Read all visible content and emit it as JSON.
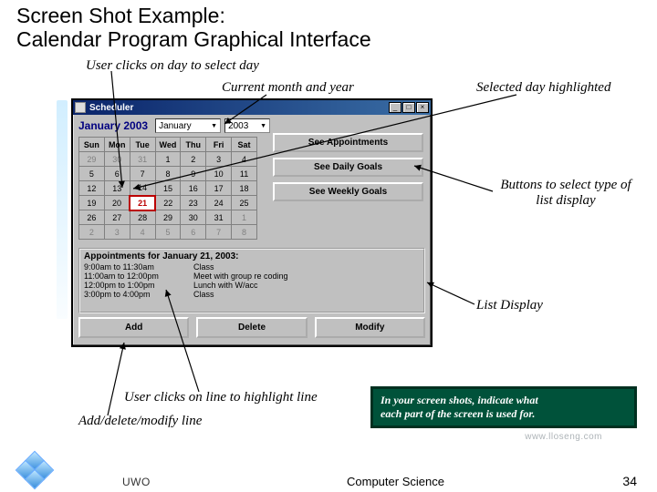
{
  "slide": {
    "title_line1": "Screen Shot Example:",
    "title_line2": "Calendar Program Graphical Interface"
  },
  "annotations": {
    "user_clicks_day": "User clicks on day to select day",
    "current_month": "Current month and year",
    "selected_day": "Selected day highlighted",
    "buttons_type": "Buttons to select type of list display",
    "list_display": "List Display",
    "user_clicks_line": "User clicks on line to highlight line",
    "add_delete_modify": "Add/delete/modify line"
  },
  "tip": {
    "line1": "In your screen shots, indicate what",
    "line2": "each part of the screen is used for."
  },
  "window": {
    "title": "Scheduler",
    "month_label": "January 2003",
    "month_select": "January",
    "year_select": "2003",
    "days": [
      "Sun",
      "Mon",
      "Tue",
      "Wed",
      "Thu",
      "Fri",
      "Sat"
    ],
    "rows": [
      [
        "29",
        "30",
        "31",
        "1",
        "2",
        "3",
        "4"
      ],
      [
        "5",
        "6",
        "7",
        "8",
        "9",
        "10",
        "11"
      ],
      [
        "12",
        "13",
        "14",
        "15",
        "16",
        "17",
        "18"
      ],
      [
        "19",
        "20",
        "21",
        "22",
        "23",
        "24",
        "25"
      ],
      [
        "26",
        "27",
        "28",
        "29",
        "30",
        "31",
        "1"
      ],
      [
        "2",
        "3",
        "4",
        "5",
        "6",
        "7",
        "8"
      ]
    ],
    "selected_cell": "21",
    "off_first": 3,
    "off_last_row5": 1,
    "side_buttons": [
      "See Appointments",
      "See Daily Goals",
      "See Weekly Goals"
    ],
    "appt_header": "Appointments for January 21, 2003:",
    "appts": [
      {
        "time": "9:00am to 11:30am",
        "desc": "Class"
      },
      {
        "time": "11:00am to 12:00pm",
        "desc": "Meet with group re coding"
      },
      {
        "time": "12:00pm to 1:00pm",
        "desc": "Lunch with W/acc"
      },
      {
        "time": "3:00pm to 4:00pm",
        "desc": "Class"
      }
    ],
    "bottom_buttons": [
      "Add",
      "Delete",
      "Modify"
    ]
  },
  "footer": {
    "pagenum": "34",
    "center": "Computer Science",
    "left": "UWO",
    "url": "www.lloseng.com"
  }
}
